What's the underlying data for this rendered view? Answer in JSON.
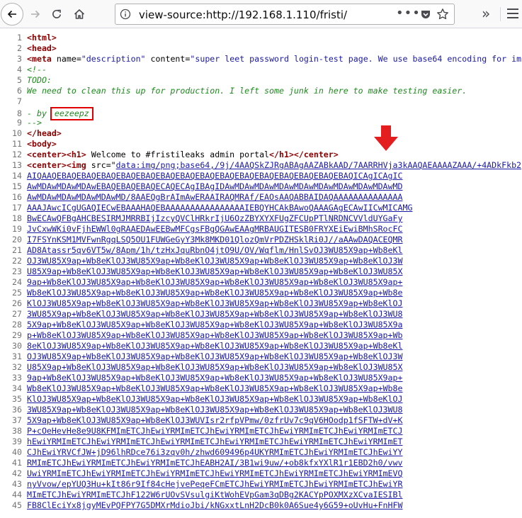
{
  "browser": {
    "url": "view-source:http://192.168.1.110/fristi/",
    "more_label": "•••"
  },
  "colors": {
    "highlight_box": "#e00000",
    "arrow": "#e41e1e",
    "tag": "#8b0000",
    "comment": "#1f8a1f",
    "link": "#1a1aa6"
  },
  "source": {
    "l1": "<html>",
    "l2": "<head>",
    "l3_tag": "meta",
    "l3_attr1": "name",
    "l3_val1": "\"description\"",
    "l3_attr2": "content",
    "l3_val2": "\"super leet password login-test page. We use base64 encoding for im",
    "l4": "<!--",
    "l5": "TODO:",
    "l6": "We need to clean this up for production. I left some junk in here to make testing easier.",
    "l7": "",
    "l8_prefix": "- by ",
    "l8_nick": "eezeepz",
    "l9": "-->",
    "l10": "</head>",
    "l11": "<body>",
    "l12_text": " Welcome to #fristileaks admin portal",
    "l13_attr": "src",
    "l13_val": "data:img/png;base64,/9j/4AAQSkZJRgABAgAAZABkAAD/7AARRHVja3kAAQAEAAAAZAAA/+4ADkFkb2",
    "base64_lines": [
      "AIQAAQEBAQEBAQEBAQEBAQEBAQEBAQEBAQEBAQEBAQEBAQEBAQEBAQEBAQEBAQEBAQICAgICAgIC",
      "AwMDAwMDAwMDAwEBAQEBAQEBAQECAQECAgIBAgIDAwMDAwMDAwMDAwMDAwMDAwMDAwMDAwMDAwMD",
      "AwMDAwMDAwMDAwMDAwMD/8AAEQgBrAImAwERAAIRAQMRAf/EAOsAAQABBAIDAQAAAAAAAAAAAAAA",
      "AAAJAwcICgUGAQIECwEBAAAHAQEBAAAAAAAAAAAAAAAAIEBQYHCAkBAwoQAAAGAgECAwIICwMICAMG",
      "BwECAwQFBgAHCBESIRMJMRRBIjIzcyQVClHRkrIjU6OzZBYXYXFUgZFCUpPTlNRDNCVVldUYGaFy",
      "JvCxwWKi0vFjhEWWl0gRAAEDAwEEBwMFCgsFBgQGAwEAAgMRBAUGITESB0FRYXEiEwiBMhSRocFC",
      "I7FSYnKSM1MVFwnRgqLSQ5OU1FUWGeGyY3Mk8MKD01QlozQmVrPDZHSklRi0J//aAAwDAQACEQMR",
      "AD8Atassr5qv6VT5w/8Apm/1h/tzHxJquRbnO4jtO9U/OV/Wqflm/HnlSvOJ3WU85X9ap+Wb8eKl",
      "OJ3WU85X9ap+Wb8eKlOJ3WU85X9ap+Wb8eKlOJ3WU85X9ap+Wb8eKlOJ3WU85X9ap+Wb8eKlOJ3W",
      "U85X9ap+Wb8eKlOJ3WU85X9ap+Wb8eKlOJ3WU85X9ap+Wb8eKlOJ3WU85X9ap+Wb8eKlOJ3WU85X",
      "9ap+Wb8eKlOJ3WU85X9ap+Wb8eKlOJ3WU85X9ap+Wb8eKlOJ3WU85X9ap+Wb8eKlOJ3WU85X9ap+",
      "Wb8eKlOJ3WU85X9ap+Wb8eKlOJ3WU85X9ap+Wb8eKlOJ3WU85X9ap+Wb8eKlOJ3WU85X9ap+Wb8e",
      "KlOJ3WU85X9ap+Wb8eKlOJ3WU85X9ap+Wb8eKlOJ3WU85X9ap+Wb8eKlOJ3WU85X9ap+Wb8eKlOJ",
      "3WU85X9ap+Wb8eKlOJ3WU85X9ap+Wb8eKlOJ3WU85X9ap+Wb8eKlOJ3WU85X9ap+Wb8eKlOJ3WU8",
      "5X9ap+Wb8eKlOJ3WU85X9ap+Wb8eKlOJ3WU85X9ap+Wb8eKlOJ3WU85X9ap+Wb8eKlOJ3WU85X9a",
      "p+Wb8eKlOJ3WU85X9ap+Wb8eKlOJ3WU85X9ap+Wb8eKlOJ3WU85X9ap+Wb8eKlOJ3WU85X9ap+Wb",
      "8eKlOJ3WU85X9ap+Wb8eKlOJ3WU85X9ap+Wb8eKlOJ3WU85X9ap+Wb8eKlOJ3WU85X9ap+Wb8eKl",
      "OJ3WU85X9ap+Wb8eKlOJ3WU85X9ap+Wb8eKlOJ3WU85X9ap+Wb8eKlOJ3WU85X9ap+Wb8eKlOJ3W",
      "U85X9ap+Wb8eKlOJ3WU85X9ap+Wb8eKlOJ3WU85X9ap+Wb8eKlOJ3WU85X9ap+Wb8eKlOJ3WU85X",
      "9ap+Wb8eKlOJ3WU85X9ap+Wb8eKlOJ3WU85X9ap+Wb8eKlOJ3WU85X9ap+Wb8eKlOJ3WU85X9ap+",
      "Wb8eKlOJ3WU85X9ap+Wb8eKlOJ3WU85X9ap+Wb8eKlOJ3WU85X9ap+Wb8eKlOJ3WU85X9ap+Wb8e",
      "KlOJ3WU85X9ap+Wb8eKlOJ3WU85X9ap+Wb8eKlOJ3WU85X9ap+Wb8eKlOJ3WU85X9ap+Wb8eKlOJ",
      "3WU85X9ap+Wb8eKlOJ3WU85X9ap+Wb8eKlOJ3WU85X9ap+Wb8eKlOJ3WU85X9ap+Wb8eKlOJ3WU8",
      "5X9ap+Wb8eKlOJ3WU85X9ap+Wb8eKlOJ3WUVIsr2rfpVPmw/0zfrUv7c9qV6HOodp1fSFTW+dV+K",
      "P+cOeHevHe8e9U8KFMImETCJhEwiYRMImETCJhEwiYRMImETCJhEwiYRMImETCJhEwiYRMImETCJ",
      "hEwiYRMImETCJhEwiYRMImETCJhEwiYRMImETCJhEwiYRMImETCJhEwiYRMImETCJhEwiYRMImET",
      "CJhEwiYRVCfJW+jD96lhRDce76i3zqv0h/zhwd609496p4UKYRMImETCJhEwiYRMImETCJhEwiYY",
      "RMImETCJhEwiYRMImETCJhEwiYRMImETCJhEABH2AI/3B1wi9uw/+ob8kfxYXlR1r1EBD2h0/vwv",
      "UwiYRMImETCJhEwiYRMImETCJhEwiYRMImETCJhEwiYRMImETCJhEwiYRMImETCJhEwiYRMImEVQ",
      "nyVvow/epYUQ3Hu+kIt86r9If84cHejvePeqeFCmETCJhEwiYRMImETCJhEwiYRMImETCJhEwiYR",
      "MImETCJhEwiYRMImETCJhF122W6rUOvSVsulgiKtWohEVpGam3qDBg2KACYpPOXMXzXCvaIESIBl",
      "FB8ClEciYx8jgyMEvPQFPY7G5DMXrMdioJbi/kNGxxtLnH2DcB0k0A6Sue4y6G59+oUvHu+FnHFW"
    ]
  }
}
